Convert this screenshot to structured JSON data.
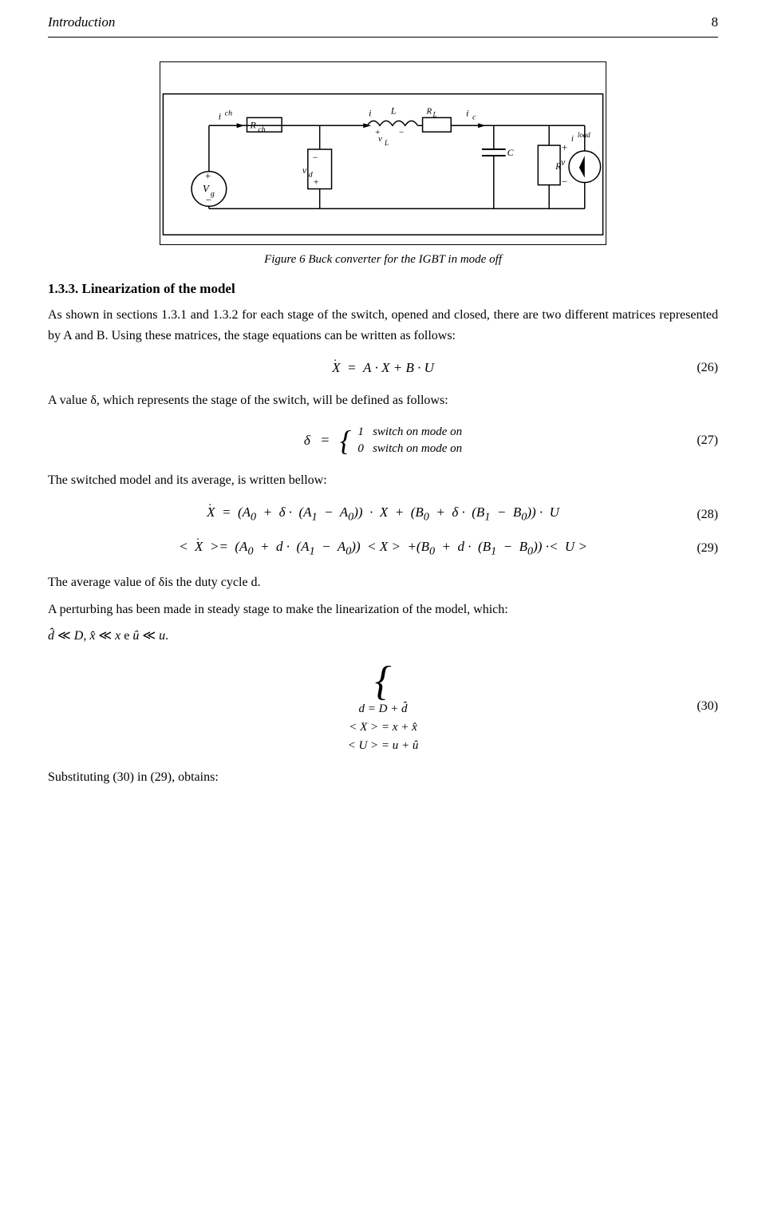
{
  "header": {
    "title": "Introduction",
    "page_number": "8"
  },
  "figure": {
    "caption": "Figure 6 Buck converter for the IGBT in mode off"
  },
  "section": {
    "number": "1.3.3.",
    "title": "Linearization of the model",
    "intro_text": "As shown in sections 1.3.1 and 1.3.2 for each stage of the switch, opened and closed, there are two different matrices represented by A and B. Using these matrices, the stage equations can be written as follows:"
  },
  "equations": {
    "eq26_label": "(26)",
    "eq27_label": "(27)",
    "eq28_label": "(28)",
    "eq29_label": "(29)",
    "eq30_label": "(30)"
  },
  "text_blocks": {
    "delta_desc": "A value δ, which represents the stage of the switch, will be defined as follows:",
    "piecewise_1": "1   switch on mode on",
    "piecewise_0": "0   switch on mode on",
    "switched_model": "The switched model and its average, is written bellow:",
    "average_value": "The average value of δis the duty cycle d.",
    "perturbing": "A perturbing has been made in steady stage to make the linearization of the model, which:",
    "hat_line": "d̂ ≪ D, x̂ ≪ x e û ≪ u.",
    "substituting": "Substituting (30) in (29), obtains:"
  }
}
